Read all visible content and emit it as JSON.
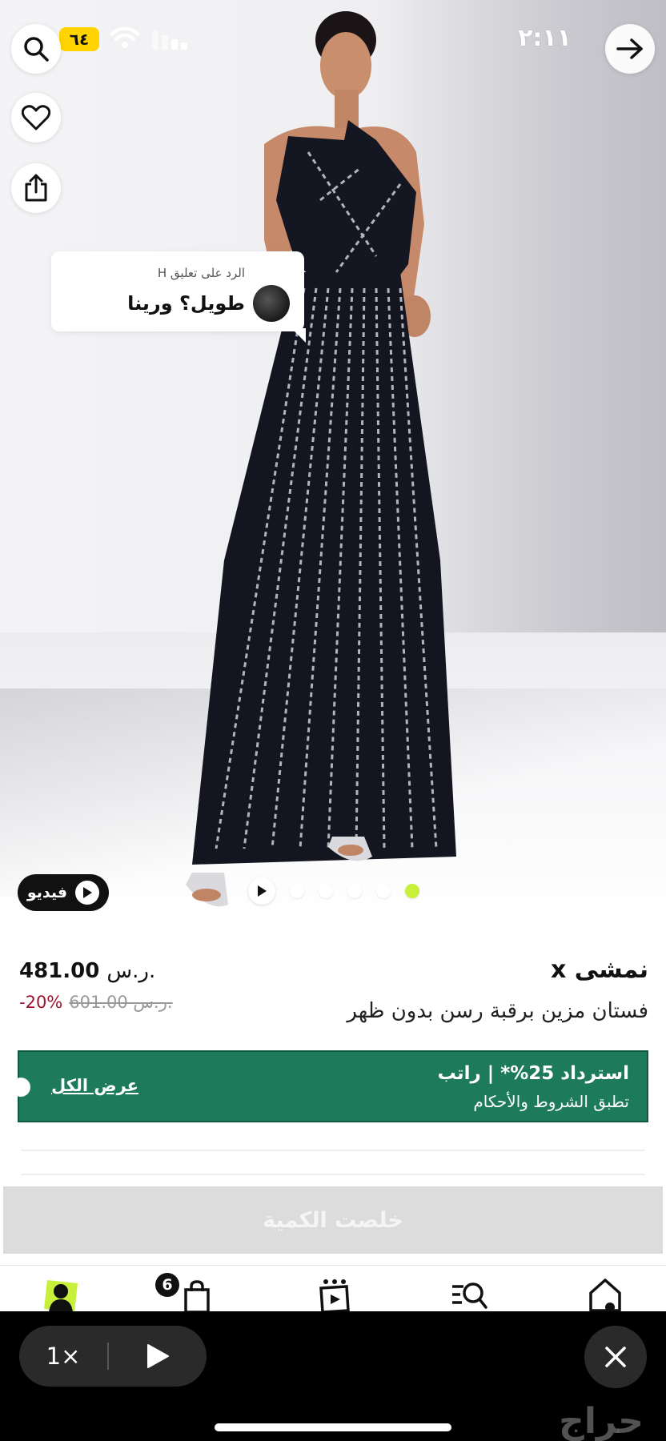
{
  "status_bar": {
    "time": "٢:١١",
    "battery": "٦٤"
  },
  "hero": {
    "comment_bubble": {
      "reply_to": "الرد على تعليق H",
      "comment": "طويل؟ ورينا"
    },
    "video_button_label": "فيديو",
    "carousel_dots": 5,
    "active_dot_index": 4
  },
  "product": {
    "brand": "نمشى x",
    "title": "فستان مزين برقبة رسن بدون ظهر",
    "price": "481.00",
    "currency": "ر.س.",
    "old_price": "601.00 ر.س.",
    "discount": "-20%"
  },
  "promo": {
    "line1": "استرداد 25%* | راتب",
    "line2": "تطبق الشروط والأحكام",
    "view_all": "عرض الكل",
    "bg_color": "#1d7a5a"
  },
  "sold_out_button": "خلصت الكمية",
  "bottom_nav": {
    "cart_badge": "6",
    "items": [
      "account-icon",
      "cart-icon",
      "videos-icon",
      "search-list-icon",
      "home-icon"
    ]
  },
  "player": {
    "speed": "1×"
  },
  "watermark": "حراج"
}
